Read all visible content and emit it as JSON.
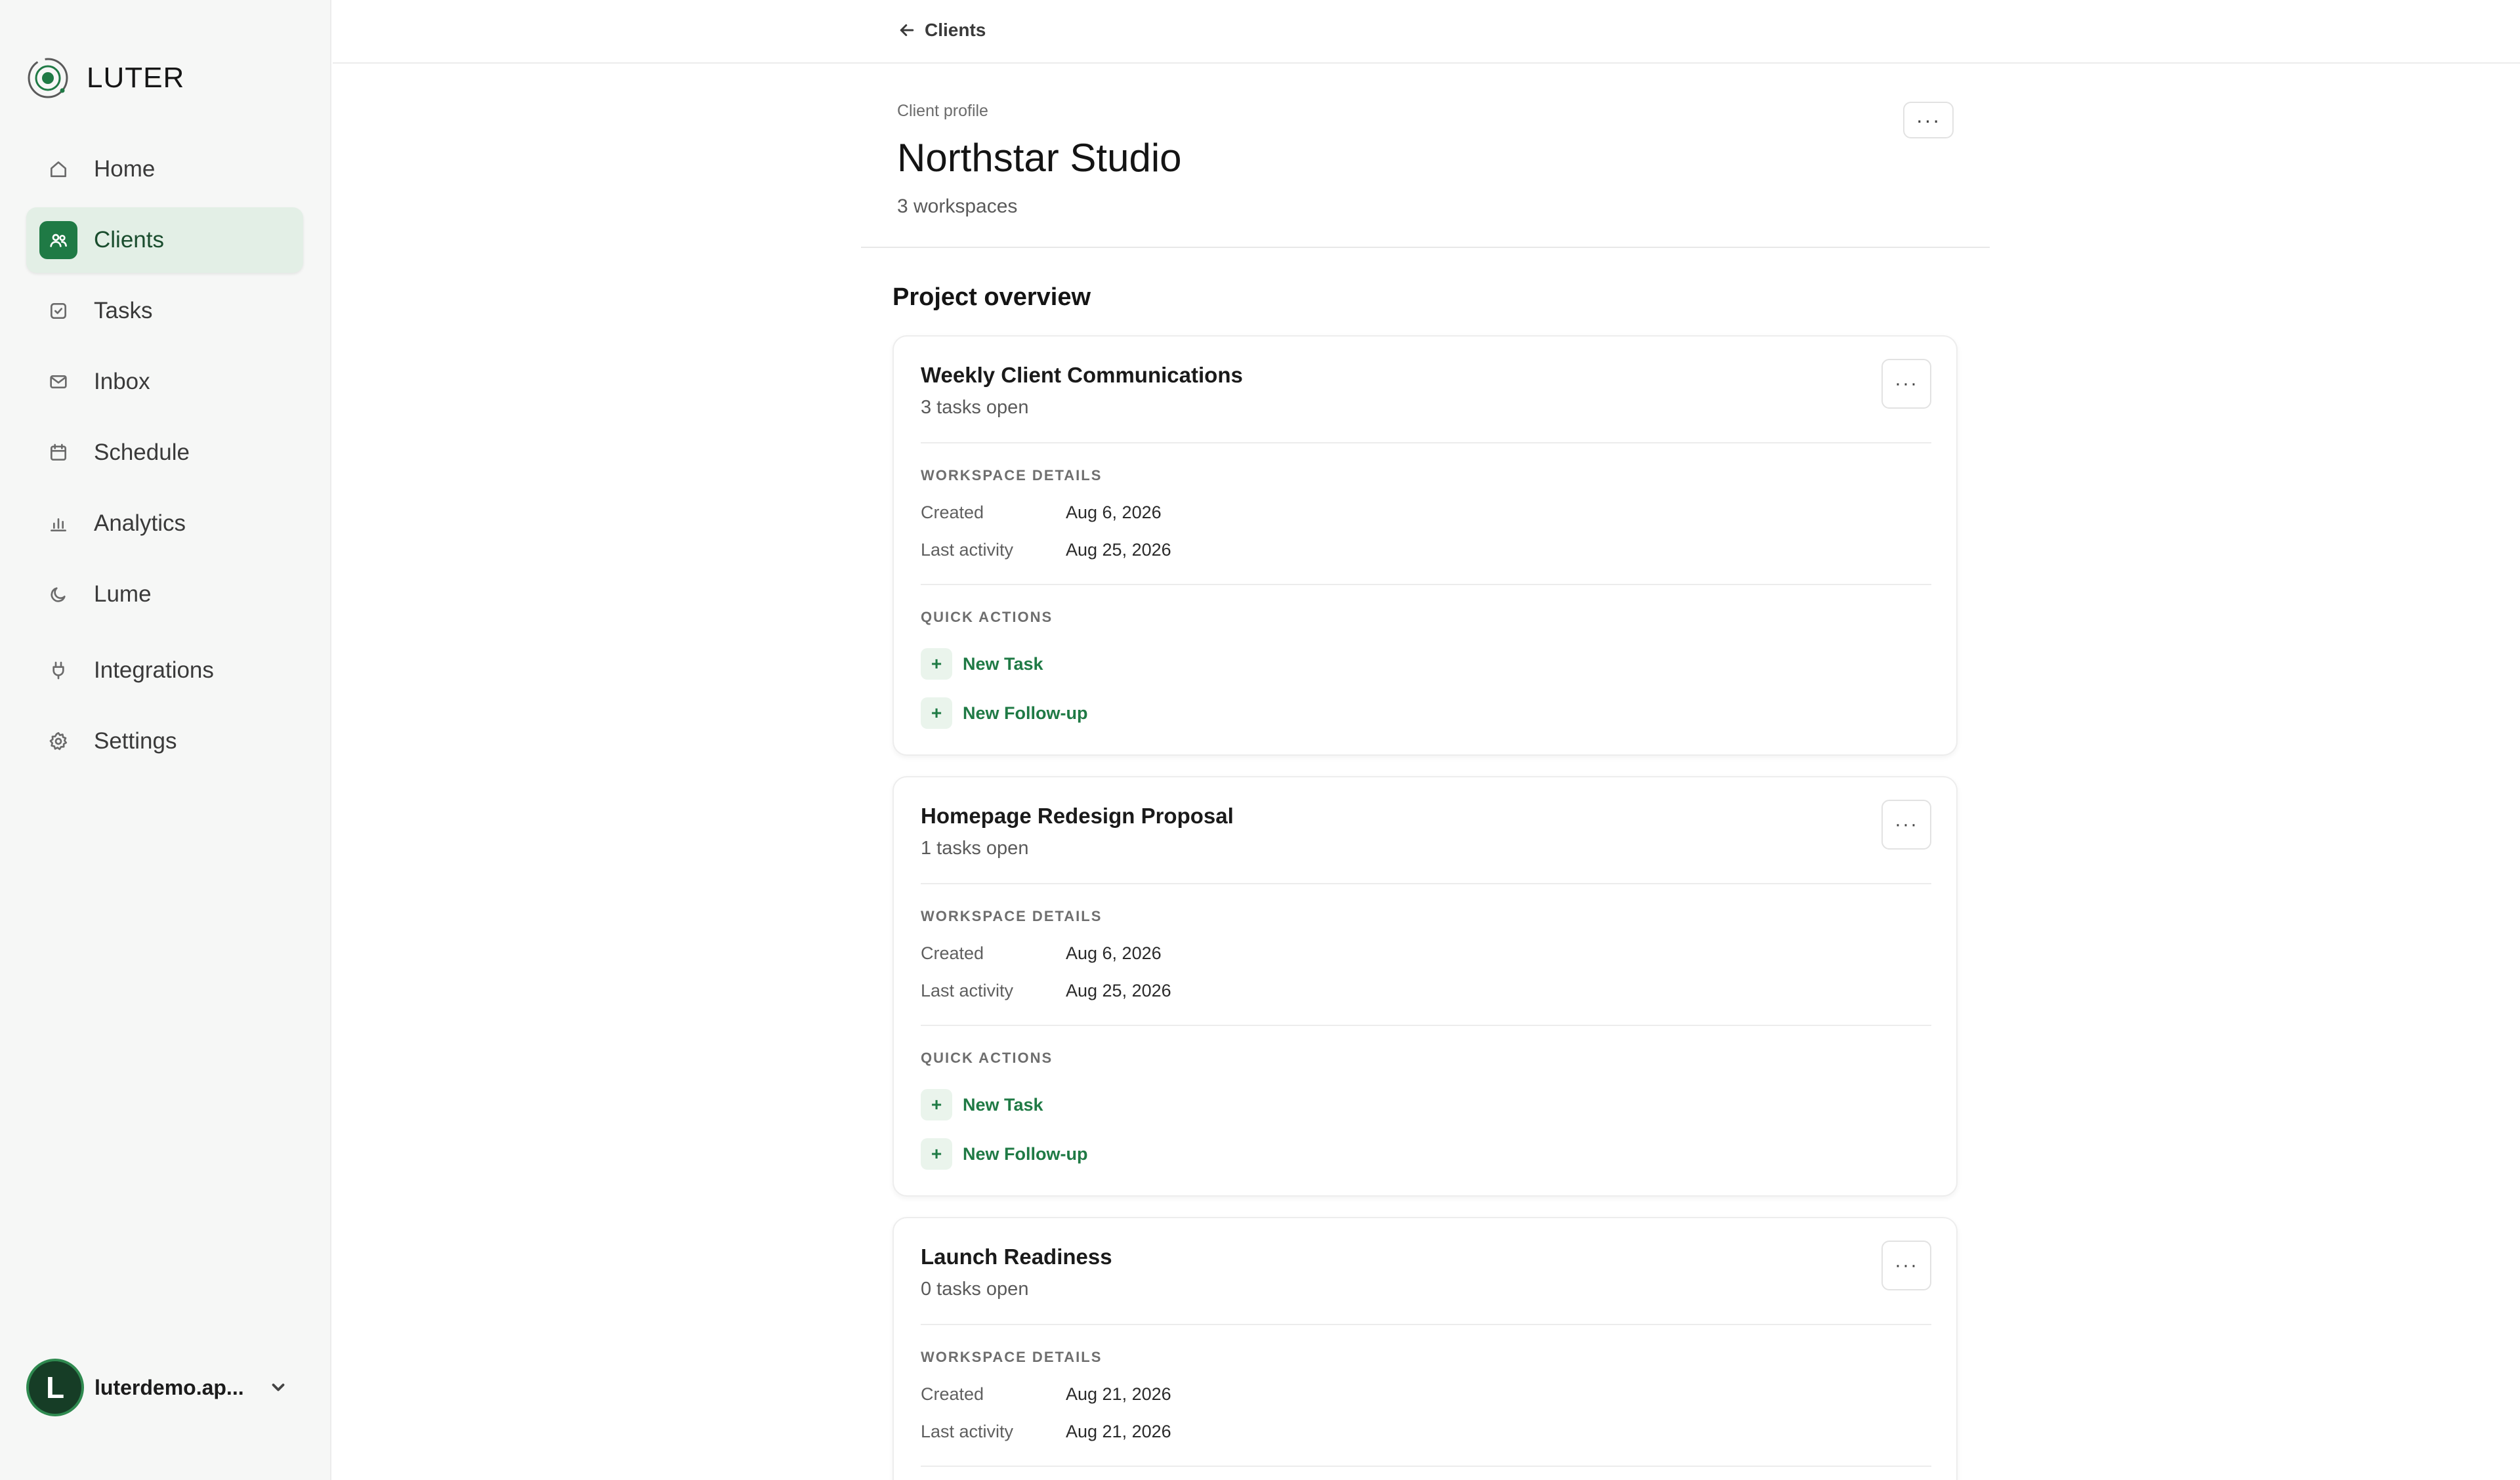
{
  "brand": {
    "name": "LUTER",
    "logo_icon": "target-logo-icon",
    "accent": "#1f7a45"
  },
  "sidebar": {
    "items": [
      {
        "label": "Home",
        "icon": "home-icon",
        "active": false
      },
      {
        "label": "Clients",
        "icon": "users-icon",
        "active": true
      },
      {
        "label": "Tasks",
        "icon": "checkbox-icon",
        "active": false
      },
      {
        "label": "Inbox",
        "icon": "mail-icon",
        "active": false
      },
      {
        "label": "Schedule",
        "icon": "calendar-icon",
        "active": false
      },
      {
        "label": "Analytics",
        "icon": "bar-chart-icon",
        "active": false
      },
      {
        "label": "Lume",
        "icon": "moon-icon",
        "active": false
      },
      {
        "label": "Integrations",
        "icon": "plug-icon",
        "active": false
      },
      {
        "label": "Settings",
        "icon": "gear-icon",
        "active": false
      }
    ],
    "user": {
      "initial": "L",
      "name": "luterdemo.ap..."
    }
  },
  "topbar": {
    "back_label": "Clients"
  },
  "header": {
    "kicker": "Client profile",
    "title": "Northstar Studio",
    "subtitle": "3 workspaces",
    "more_label": "···"
  },
  "section_title": "Project overview",
  "cards": [
    {
      "title": "Weekly Client Communications",
      "subtitle": "3 tasks open",
      "details_label": "WORKSPACE DETAILS",
      "created_label": "Created",
      "created_value": "Aug 6, 2026",
      "activity_label": "Last activity",
      "activity_value": "Aug 25, 2026",
      "actions_label": "QUICK ACTIONS",
      "actions": [
        "New Task",
        "New Follow-up"
      ],
      "plus": "+",
      "more_label": "···"
    },
    {
      "title": "Homepage Redesign Proposal",
      "subtitle": "1 tasks open",
      "details_label": "WORKSPACE DETAILS",
      "created_label": "Created",
      "created_value": "Aug 6, 2026",
      "activity_label": "Last activity",
      "activity_value": "Aug 25, 2026",
      "actions_label": "QUICK ACTIONS",
      "actions": [
        "New Task",
        "New Follow-up"
      ],
      "plus": "+",
      "more_label": "···"
    },
    {
      "title": "Launch Readiness",
      "subtitle": "0 tasks open",
      "details_label": "WORKSPACE DETAILS",
      "created_label": "Created",
      "created_value": "Aug 21, 2026",
      "activity_label": "Last activity",
      "activity_value": "Aug 21, 2026",
      "more_label": "···"
    }
  ]
}
